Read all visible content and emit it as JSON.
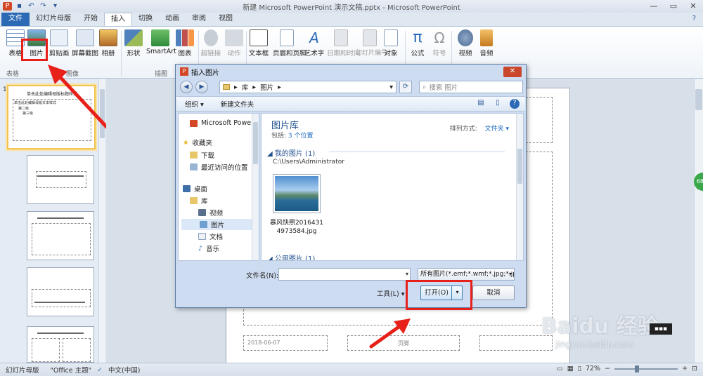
{
  "window": {
    "title": "新建 Microsoft PowerPoint 演示文稿.pptx - Microsoft PowerPoint",
    "help": "?"
  },
  "tabs": [
    "文件",
    "幻灯片母版",
    "开始",
    "插入",
    "切换",
    "动画",
    "审阅",
    "视图"
  ],
  "ribbon": {
    "buttons": [
      {
        "label": "表格",
        "icon": "table-icon"
      },
      {
        "label": "图片",
        "icon": "picture-icon"
      },
      {
        "label": "剪贴画",
        "icon": "clipart-icon"
      },
      {
        "label": "屏幕截图",
        "icon": "screenshot-icon"
      },
      {
        "label": "相册",
        "icon": "album-icon"
      },
      {
        "label": "形状",
        "icon": "shapes-icon"
      },
      {
        "label": "SmartArt",
        "icon": "smartart-icon"
      },
      {
        "label": "图表",
        "icon": "chart-icon"
      },
      {
        "label": "超链接",
        "icon": "hyperlink-icon"
      },
      {
        "label": "动作",
        "icon": "action-icon"
      },
      {
        "label": "文本框",
        "icon": "textbox-icon"
      },
      {
        "label": "页眉和页脚",
        "icon": "header-footer-icon"
      },
      {
        "label": "艺术字",
        "icon": "wordart-icon"
      },
      {
        "label": "日期和时间",
        "icon": "datetime-icon"
      },
      {
        "label": "幻灯片编号",
        "icon": "slide-number-icon"
      },
      {
        "label": "对象",
        "icon": "object-icon"
      },
      {
        "label": "公式",
        "icon": "equation-icon"
      },
      {
        "label": "符号",
        "icon": "symbol-icon"
      },
      {
        "label": "视频",
        "icon": "video-icon"
      },
      {
        "label": "音频",
        "icon": "audio-icon"
      }
    ],
    "groups": [
      "表格",
      "图像",
      "插图"
    ]
  },
  "slide_thumbs": {
    "first_number": "1",
    "master_title": "单击此处编辑母版标题样式",
    "master_text": "单击此处编辑母版文本样式",
    "level2": "第二级",
    "level3": "第三级"
  },
  "slide": {
    "date": "2018-06-07",
    "footer": "页脚"
  },
  "dialog": {
    "title": "插入图片",
    "close": "✕",
    "address": [
      "库",
      "图片"
    ],
    "search_placeholder": "搜索 图片",
    "toolbar": {
      "organize": "组织 ▾",
      "new_folder": "新建文件夹"
    },
    "nav": [
      {
        "label": "Microsoft PowerPoint",
        "icon": "powerpoint-icon"
      },
      {
        "label": "收藏夹",
        "icon": "star-icon"
      },
      {
        "label": "下载",
        "icon": "download-icon"
      },
      {
        "label": "最近访问的位置",
        "icon": "recent-icon"
      },
      {
        "label": "桌面",
        "icon": "desktop-icon"
      },
      {
        "label": "库",
        "icon": "library-icon"
      },
      {
        "label": "视频",
        "icon": "video-folder-icon"
      },
      {
        "label": "图片",
        "icon": "pictures-folder-icon"
      },
      {
        "label": "文档",
        "icon": "documents-folder-icon"
      },
      {
        "label": "音乐",
        "icon": "music-folder-icon"
      }
    ],
    "library": {
      "title": "图片库",
      "includes_label": "包括:",
      "includes_value": "3 个位置",
      "sort_label": "排列方式:",
      "sort_value": "文件夹 ▾",
      "group1": "我的图片 (1)",
      "group1_path": "C:\\Users\\Administrator",
      "photo_caption": "暴风快照20164314973584.jpg",
      "group2": "公用图片 (1)"
    },
    "filename_label": "文件名(N):",
    "filename_value": "",
    "filetype": "所有图片(*.emf;*.wmf;*.jpg;*.jp",
    "tools": "工具(L) ▾",
    "open": "打开(O)",
    "cancel": "取消"
  },
  "status": {
    "view": "幻灯片母版",
    "theme": "\"Office 主题\"",
    "lang": "中文(中国)",
    "zoom": "72%",
    "zoom_fraction": 0.72
  },
  "watermark": {
    "brand": "Baidu 经验",
    "url": "jingyan.baidu.com"
  },
  "badge": "68",
  "colors": {
    "accent": "#2c6ab5",
    "highlight": "#e8201a",
    "arrow": "#e8201a"
  }
}
